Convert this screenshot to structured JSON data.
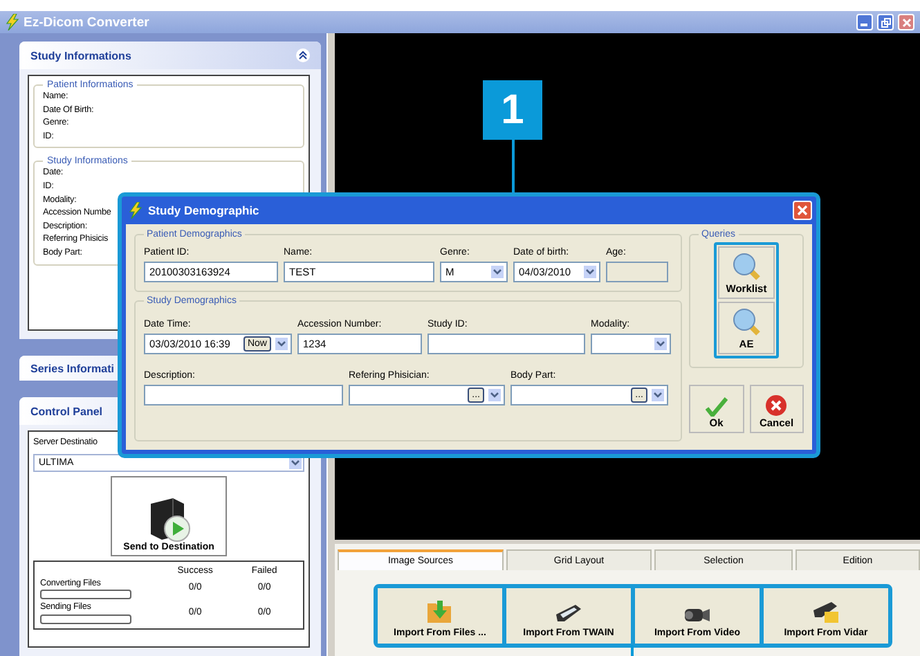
{
  "window": {
    "title": "Ez-Dicom Converter"
  },
  "left_panel": {
    "study_info": {
      "title": "Study Informations",
      "expanded": true,
      "groups": [
        {
          "title": "Patient Informations",
          "fields": [
            "Name:",
            "Date Of Birth:",
            "Genre:",
            "ID:"
          ]
        },
        {
          "title": "Study Informations",
          "fields": [
            "Date:",
            "ID:",
            "Modality:",
            "Accession Numbe",
            "Description:",
            "Referring Phisicis",
            "Body Part:"
          ]
        }
      ]
    },
    "series_info": {
      "title": "Series Informati"
    },
    "control_panel": {
      "title": "Control Panel",
      "server_label": "Server Destinatio",
      "server_value": "ULTIMA",
      "send_button": "Send to Destination",
      "columns": [
        "Success",
        "Failed"
      ],
      "rows": [
        {
          "label": "Converting Files",
          "level": 0,
          "success": "0/0",
          "failed": "0/0"
        },
        {
          "label": "Sending Files",
          "level": 0,
          "success": "0/0",
          "failed": "0/0"
        }
      ]
    }
  },
  "callout": "1",
  "dialog": {
    "title": "Study Demographic",
    "patient": {
      "title": "Patient Demographics",
      "fields": [
        {
          "label": "Patient ID:",
          "value": "20100303163924",
          "kind": "text"
        },
        {
          "label": "Name:",
          "value": "TEST",
          "kind": "text"
        },
        {
          "label": "Genre:",
          "value": "M",
          "kind": "select"
        },
        {
          "label": "Date of birth:",
          "value": "04/03/2010",
          "kind": "select"
        },
        {
          "label": "Age:",
          "kind": "text",
          "disabled": true
        }
      ]
    },
    "study": {
      "title": "Study Demographics",
      "fields": [
        {
          "label": "Date Time:",
          "value": "03/03/2010 16:39",
          "kind": "datetime",
          "button": "Now"
        },
        {
          "label": "Accession Number:",
          "value": "1234",
          "kind": "text"
        },
        {
          "label": "Study ID:",
          "kind": "text"
        },
        {
          "label": "Modality:",
          "kind": "select"
        },
        {
          "label": "Description:",
          "kind": "text"
        },
        {
          "label": "Refering Phisician:",
          "kind": "picker",
          "button": "..."
        },
        {
          "label": "Body Part:",
          "kind": "picker",
          "button": "..."
        }
      ]
    },
    "queries": {
      "title": "Queries",
      "buttons": [
        "Worklist",
        "AE"
      ]
    },
    "actions": [
      {
        "label": "Ok",
        "kind": "ok"
      },
      {
        "label": "Cancel",
        "kind": "cancel"
      }
    ]
  },
  "bottom": {
    "tabs": [
      {
        "label": "Image Sources",
        "selected": true
      },
      {
        "label": "Grid Layout",
        "selected": false
      },
      {
        "label": "Selection",
        "selected": false
      },
      {
        "label": "Edition",
        "selected": false
      }
    ],
    "buttons": [
      {
        "label": "Import From Files ...",
        "kind": "files"
      },
      {
        "label": "Import From TWAIN",
        "kind": "scanner"
      },
      {
        "label": "Import From Video",
        "kind": "video"
      },
      {
        "label": "Import From Vidar",
        "kind": "vidar"
      }
    ]
  }
}
